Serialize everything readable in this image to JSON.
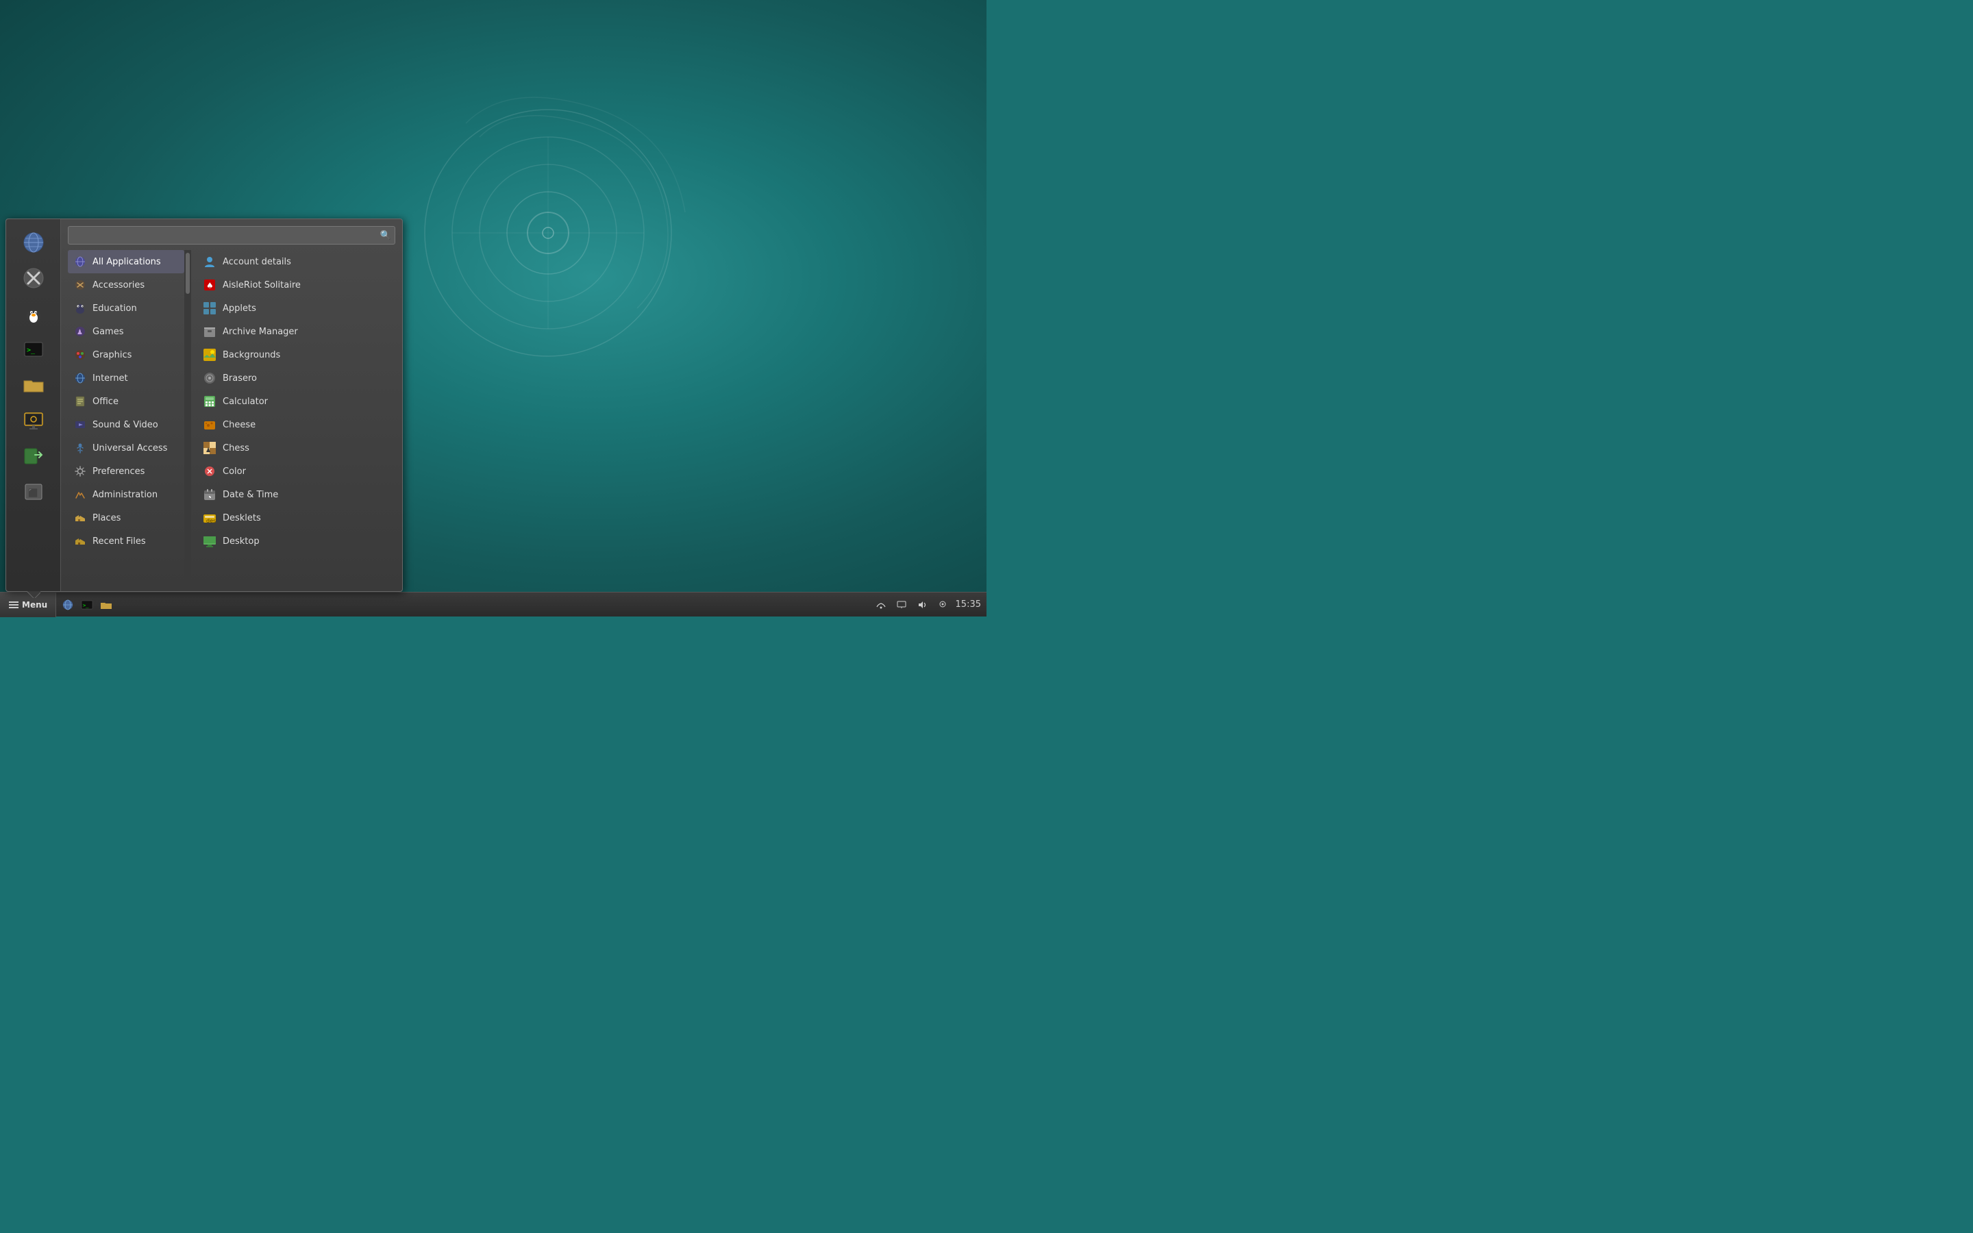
{
  "desktop": {
    "background_color": "#1a7070"
  },
  "taskbar": {
    "menu_label": "Menu",
    "time": "15:35",
    "icons": [
      "globe-icon",
      "terminal-icon",
      "folder-icon"
    ]
  },
  "app_menu": {
    "search_placeholder": "",
    "categories": [
      {
        "id": "all",
        "label": "All Applications",
        "icon": "🌐",
        "active": true
      },
      {
        "id": "accessories",
        "label": "Accessories",
        "icon": "🔧"
      },
      {
        "id": "education",
        "label": "Education",
        "icon": "🐧"
      },
      {
        "id": "games",
        "label": "Games",
        "icon": "🎮"
      },
      {
        "id": "graphics",
        "label": "Graphics",
        "icon": "🎨"
      },
      {
        "id": "internet",
        "label": "Internet",
        "icon": "🌍"
      },
      {
        "id": "office",
        "label": "Office",
        "icon": "📄"
      },
      {
        "id": "sound_video",
        "label": "Sound & Video",
        "icon": "🎵"
      },
      {
        "id": "universal_access",
        "label": "Universal Access",
        "icon": "♿"
      },
      {
        "id": "preferences",
        "label": "Preferences",
        "icon": "⚙️"
      },
      {
        "id": "administration",
        "label": "Administration",
        "icon": "🔧"
      },
      {
        "id": "places",
        "label": "Places",
        "icon": "📁"
      },
      {
        "id": "recent",
        "label": "Recent Files",
        "icon": "📁"
      }
    ],
    "apps": [
      {
        "label": "Account details",
        "icon": "👤",
        "color": "#4a9fd4"
      },
      {
        "label": "AisleRiot Solitaire",
        "icon": "🃏",
        "color": "#d45050"
      },
      {
        "label": "Applets",
        "icon": "⚙",
        "color": "#4a9fd4"
      },
      {
        "label": "Archive Manager",
        "icon": "📦",
        "color": "#888"
      },
      {
        "label": "Backgrounds",
        "icon": "🖼",
        "color": "#d4a500"
      },
      {
        "label": "Brasero",
        "icon": "💿",
        "color": "#888"
      },
      {
        "label": "Calculator",
        "icon": "🖩",
        "color": "#5aad5a"
      },
      {
        "label": "Cheese",
        "icon": "📷",
        "color": "#d4a500"
      },
      {
        "label": "Chess",
        "icon": "♟",
        "color": "#888"
      },
      {
        "label": "Color",
        "icon": "🎨",
        "color": "#d45050"
      },
      {
        "label": "Date & Time",
        "icon": "🕐",
        "color": "#888"
      },
      {
        "label": "Desklets",
        "icon": "🟡",
        "color": "#d4a500"
      },
      {
        "label": "Desktop",
        "icon": "🟩",
        "color": "#5aad5a"
      }
    ]
  },
  "sidebar_icons": [
    {
      "name": "globe",
      "symbol": "🌐"
    },
    {
      "name": "tools",
      "symbol": "⚒"
    },
    {
      "name": "penguin",
      "symbol": "🐧"
    },
    {
      "name": "terminal",
      "symbol": "🖥"
    },
    {
      "name": "folder",
      "symbol": "📁"
    },
    {
      "name": "monitor",
      "symbol": "🖥"
    },
    {
      "name": "logout",
      "symbol": "🚪"
    },
    {
      "name": "lock",
      "symbol": "🔒"
    }
  ]
}
